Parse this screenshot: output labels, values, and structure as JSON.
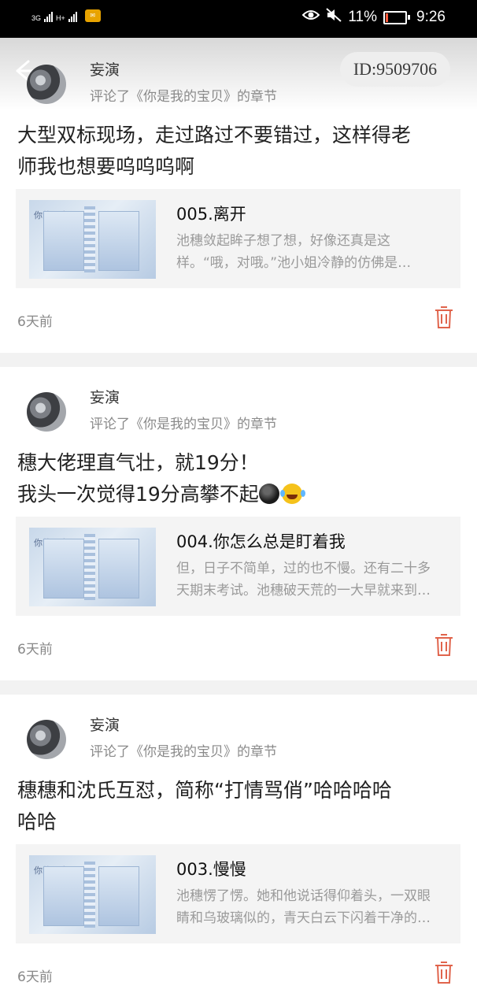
{
  "status_bar": {
    "network_left": "3G",
    "network_right": "H+",
    "battery": "11%",
    "time": "9:26"
  },
  "header": {
    "id_badge": "ID:9509706"
  },
  "comments": [
    {
      "username": "妄演",
      "subtitle": "评论了《你是我的宝贝》的章节",
      "text_lines": [
        "大型双标现场，走过路过不要错过，这样得老",
        "师我也想要呜呜呜啊"
      ],
      "chapter": {
        "title": "005.离开",
        "excerpt_lines": [
          "池穗敛起眸子想了想，好像还真是这",
          "样。“哦，对哦。”池小姐冷静的仿佛是…"
        ]
      },
      "time": "6天前"
    },
    {
      "username": "妄演",
      "subtitle": "评论了《你是我的宝贝》的章节",
      "text_lines": [
        "穗大佬理直气壮，就19分！",
        "我头一次觉得19分高攀不起"
      ],
      "chapter": {
        "title": "004.你怎么总是盯着我",
        "excerpt_lines": [
          "但，日子不简单，过的也不慢。还有二十多",
          "天期末考试。池穗破天荒的一大早就来到…"
        ]
      },
      "time": "6天前"
    },
    {
      "username": "妄演",
      "subtitle": "评论了《你是我的宝贝》的章节",
      "text_lines": [
        "穗穗和沈氏互怼，简称“打情骂俏”哈哈哈哈",
        "哈哈"
      ],
      "chapter": {
        "title": "003.慢慢",
        "excerpt_lines": [
          "池穗愣了愣。她和他说话得仰着头，一双眼",
          "睛和乌玻璃似的，青天白云下闪着干净的…"
        ]
      },
      "time": "6天前"
    }
  ],
  "cover_title": "你的是宝贝",
  "colors": {
    "delete_icon": "#e0644c",
    "chapter_bg": "#f4f4f4",
    "separator": "#f2f2f2"
  }
}
